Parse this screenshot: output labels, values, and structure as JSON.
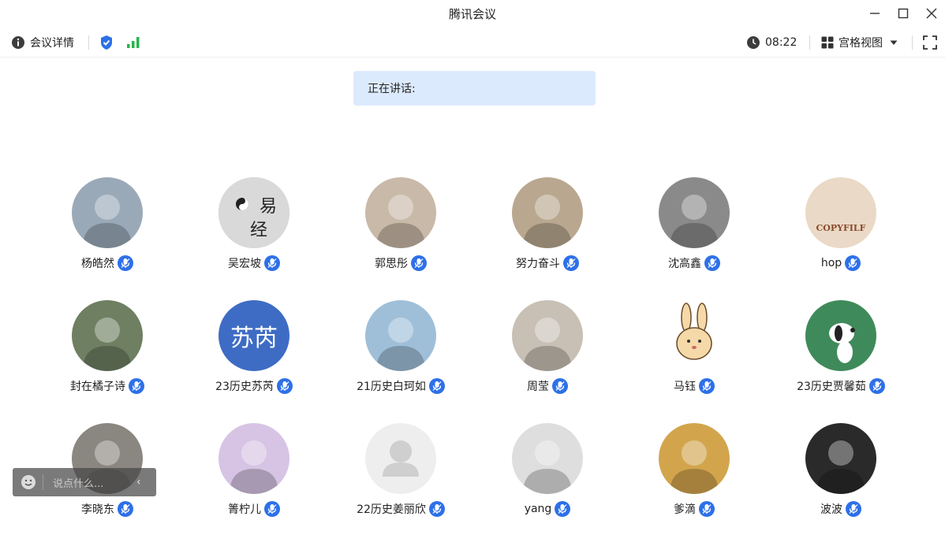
{
  "window": {
    "title": "腾讯会议",
    "controls": [
      "minimize-icon",
      "maximize-icon",
      "close-icon"
    ]
  },
  "toolbar": {
    "meeting_details_label": "会议详情",
    "timer": "08:22",
    "view_label": "宫格视图"
  },
  "speaking": {
    "label": "正在讲话:"
  },
  "participants": [
    {
      "name": "杨皓然",
      "avatar": "statue-photo",
      "bg": "#9aa9b8"
    },
    {
      "name": "吴宏坡",
      "avatar": "yijing-calligraphy",
      "bg": "#bcbcbc"
    },
    {
      "name": "郭思彤",
      "avatar": "girl-photo",
      "bg": "#c9b9a8"
    },
    {
      "name": "努力奋斗",
      "avatar": "girl-photo",
      "bg": "#b9a88f"
    },
    {
      "name": "沈高鑫",
      "avatar": "manga-boy",
      "bg": "#8a8a8a"
    },
    {
      "name": "hop",
      "avatar": "copyfilf-logo",
      "bg": "#ead9c6",
      "text": "COPYFILF"
    },
    {
      "name": "封在橘子诗",
      "avatar": "painting",
      "bg": "#6e7f62"
    },
    {
      "name": "23历史苏芮",
      "avatar": "text-avatar",
      "bg": "#3e6cc4",
      "text": "苏芮"
    },
    {
      "name": "21历史白珂如",
      "avatar": "girl-photo",
      "bg": "#9fbfd9"
    },
    {
      "name": "周莹",
      "avatar": "girl-photo",
      "bg": "#c8c0b5"
    },
    {
      "name": "马钰",
      "avatar": "rabbit-cartoon",
      "bg": "#ffffff"
    },
    {
      "name": "23历史贾馨茹",
      "avatar": "snoopy",
      "bg": "#3f8a5a"
    },
    {
      "name": "李晓东",
      "avatar": "boy-photo",
      "bg": "#8a8680"
    },
    {
      "name": "箐柠儿",
      "avatar": "anime-girl",
      "bg": "#d7c4e4"
    },
    {
      "name": "22历史姜丽欣",
      "avatar": "default-user",
      "bg": "#eeeeee"
    },
    {
      "name": "yang",
      "avatar": "girl-photo",
      "bg": "#dedede"
    },
    {
      "name": "爹滴",
      "avatar": "historical-figure",
      "bg": "#d2a54d"
    },
    {
      "name": "波波",
      "avatar": "man-photo",
      "bg": "#2a2a2a"
    }
  ],
  "chat": {
    "placeholder": "说点什么..."
  },
  "colors": {
    "accent": "#2d70e8",
    "speaking_bg": "#dceafd",
    "signal": "#27b34a"
  }
}
